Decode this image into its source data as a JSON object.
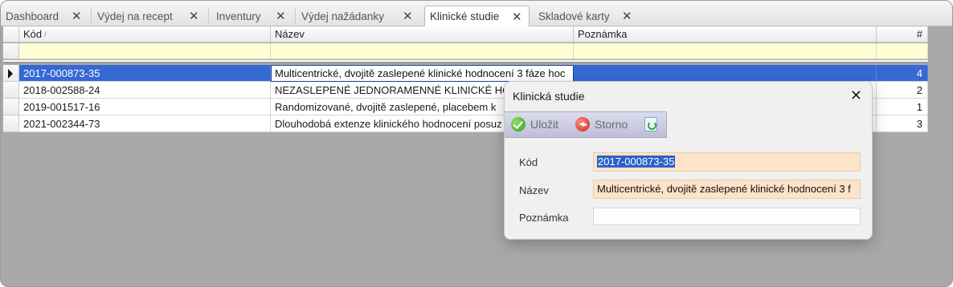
{
  "tabs": [
    {
      "label": "Dashboard",
      "close": "✕"
    },
    {
      "label": "Výdej na recept",
      "close": "✕"
    },
    {
      "label": "Inventury",
      "close": "✕"
    },
    {
      "label": "Výdej nažádanky",
      "close": "✕"
    },
    {
      "label": "Klinické studie",
      "close": "✕"
    },
    {
      "label": "Skladové karty",
      "close": "✕"
    }
  ],
  "grid": {
    "columns": {
      "kod": "Kód",
      "nazev": "Název",
      "poznamka": "Poznámka",
      "num": "#"
    },
    "sort_indicator": "/",
    "rows": [
      {
        "kod": "2017-000873-35",
        "nazev": "Multicentrické, dvojitě zaslepené klinické hodnocení 3 fáze hoc",
        "poznamka": "",
        "num": "4"
      },
      {
        "kod": "2018-002588-24",
        "nazev": "NEZASLEPENÉ JEDNORAMENNÉ KLINICKÉ HODN",
        "poznamka": "",
        "num": "2"
      },
      {
        "kod": "2019-001517-16",
        "nazev": "Randomizované, dvojitě zaslepené, placebem k",
        "poznamka": "",
        "num": "1"
      },
      {
        "kod": "2021-002344-73",
        "nazev": "Dlouhodobá extenze klinického hodnocení posuz",
        "poznamka": "",
        "num": "3"
      }
    ]
  },
  "dialog": {
    "title": "Klinická studie",
    "close": "✕",
    "toolbar": {
      "save": "Uložit",
      "cancel": "Storno"
    },
    "fields": {
      "kod_label": "Kód",
      "kod_value": "2017-000873-35",
      "nazev_label": "Název",
      "nazev_value": "Multicentrické, dvojitě zaslepené klinické hodnocení 3 f",
      "poznamka_label": "Poznámka",
      "poznamka_value": ""
    }
  },
  "colors": {
    "selection": "#3669d4",
    "filter_row": "#fffed5",
    "input_highlight": "#fde3c8"
  }
}
